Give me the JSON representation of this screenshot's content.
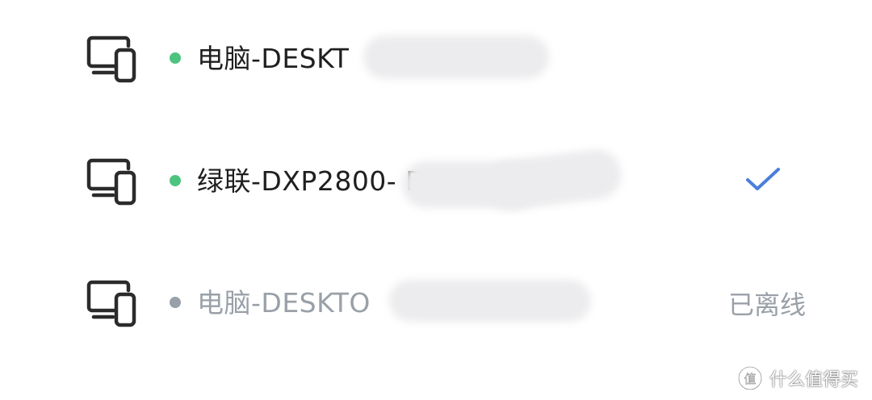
{
  "devices": [
    {
      "icon": "devices-icon",
      "status": "online",
      "status_color": "#4cc47f",
      "name": "电脑-DESKT",
      "trailing": ""
    },
    {
      "icon": "devices-icon",
      "status": "online",
      "status_color": "#4cc47f",
      "name": "绿联-DXP2800-                    PA…",
      "trailing": "check-icon",
      "trailing_color": "#4a7fdc"
    },
    {
      "icon": "devices-icon",
      "status": "offline",
      "status_color": "#9aa0a8",
      "name": "电脑-DESKTO",
      "trailing": "已离线"
    }
  ],
  "watermark": {
    "icon": "zhi-logo-icon",
    "text": "什么值得买"
  }
}
